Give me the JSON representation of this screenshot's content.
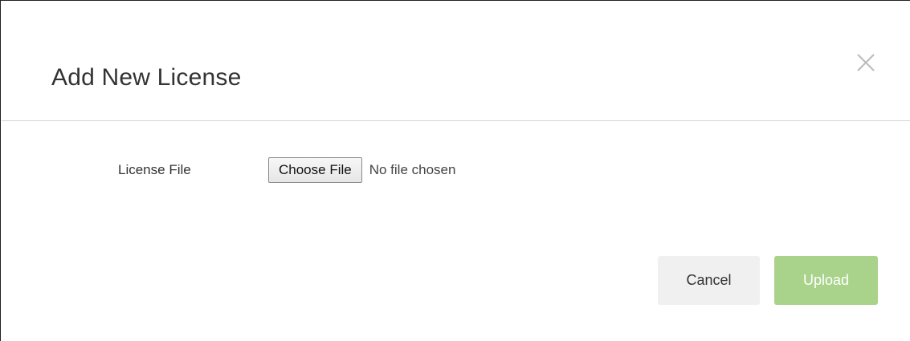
{
  "modal": {
    "title": "Add New License",
    "close_icon": "close-icon"
  },
  "form": {
    "license_file": {
      "label": "License File",
      "choose_button_label": "Choose File",
      "status_text": "No file chosen"
    }
  },
  "footer": {
    "cancel_label": "Cancel",
    "upload_label": "Upload",
    "upload_color": "#a9d38b",
    "upload_disabled": true
  }
}
